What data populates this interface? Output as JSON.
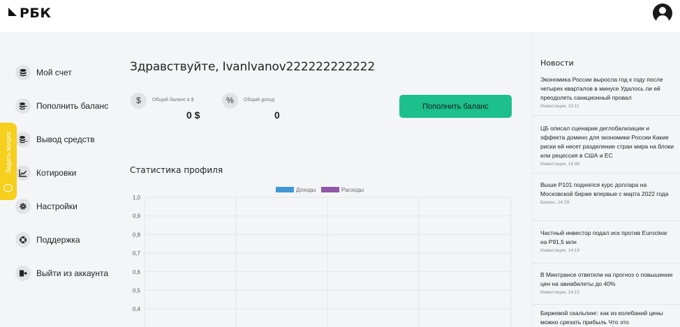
{
  "header": {
    "logo_text": "РБК",
    "user_icon": "user-avatar-icon"
  },
  "sidebar": {
    "items": [
      {
        "label": "Мой счет",
        "icon": "coins-icon"
      },
      {
        "label": "Пополнить баланс",
        "icon": "coins-plus-icon"
      },
      {
        "label": "Вывод средств",
        "icon": "coins-minus-icon"
      },
      {
        "label": "Котировки",
        "icon": "chart-line-icon"
      },
      {
        "label": "Настройки",
        "icon": "gear-icon"
      },
      {
        "label": "Поддержка",
        "icon": "lifebuoy-icon"
      },
      {
        "label": "Выйти из аккаунта",
        "icon": "logout-icon"
      }
    ],
    "ask_question": "Задать вопрос"
  },
  "main": {
    "greeting": "Здравствуйте, IvanIvanov222222222222",
    "balance": {
      "icon_glyph": "$",
      "label": "Общий баланс в $",
      "value": "0 $"
    },
    "income": {
      "icon_glyph": "%",
      "label": "Общий доход",
      "value": "0"
    },
    "topup_button": "Пополнить баланс",
    "stats_title": "Статистика профиля"
  },
  "chart_data": {
    "type": "line",
    "series": [
      {
        "name": "Доходы",
        "color": "#3f98d3",
        "values": []
      },
      {
        "name": "Расходы",
        "color": "#8e5aa8",
        "values": []
      }
    ],
    "y_ticks": [
      "1,0",
      "0,9",
      "0,8",
      "0,7",
      "0,6",
      "0,5",
      "0,4"
    ],
    "ylim": [
      0,
      1
    ],
    "grid": true,
    "legend_position": "top-center"
  },
  "news": {
    "title": "Новости",
    "items": [
      {
        "text": "Экономика России выросла год к году после четырех кварталов в минусе Удалось ли ей преодолеть санкционный провал",
        "meta": "Инвестиции, 15:11"
      },
      {
        "text": "ЦБ описал сценарии деглобализации и эффекта домино для экономики России Какие риски ей несет разделение стран мира на блоки или рецессия в США и ЕС",
        "meta": "Инвестиции, 14:49"
      },
      {
        "text": "Выше Р101 поднялся курс доллара на Московской бирже впервые с марта 2022 года",
        "meta": "Бизнес, 14:29"
      },
      {
        "text": "Частный инвестор подал иск против Euroclear на Р91,5 млн",
        "meta": "Инвестиции, 14:19"
      },
      {
        "text": "В Минтрансе ответили на прогноз о повышении цен на авиабилеты до 40%",
        "meta": "Инвестиции, 14:15"
      },
      {
        "text": "Биржевой скальпинг: как из колебаний цены можно срезать прибыль Что это",
        "meta": ""
      }
    ]
  }
}
